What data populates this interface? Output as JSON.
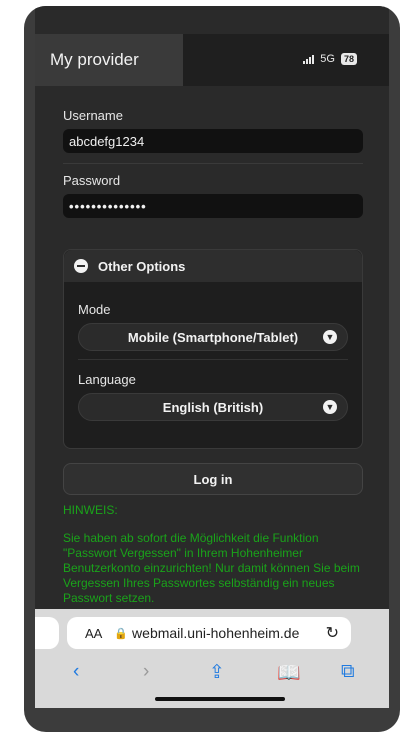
{
  "header": {
    "title": "My provider",
    "network": "5G",
    "battery": "78"
  },
  "form": {
    "username_label": "Username",
    "username_value": "abcdefg1234",
    "password_label": "Password",
    "password_value": "••••••••••••••"
  },
  "options": {
    "header": "Other Options",
    "mode_label": "Mode",
    "mode_value": "Mobile (Smartphone/Tablet)",
    "language_label": "Language",
    "language_value": "English (British)"
  },
  "login_label": "Log in",
  "hint": {
    "title": "HINWEIS:",
    "text": "Sie haben ab sofort die Möglichkeit die Funktion \"Passwort Vergessen\" in Ihrem Hohenheimer Benutzerkonto einzurichten! Nur damit können Sie beim Vergessen Ihres Passwortes selbständig ein neues Passwort setzen."
  },
  "browser": {
    "aa_label": "AA",
    "url": "webmail.uni-hohenheim.de"
  },
  "colors": {
    "hint_green": "#1aa31a",
    "link_blue": "#1f7ae0"
  }
}
